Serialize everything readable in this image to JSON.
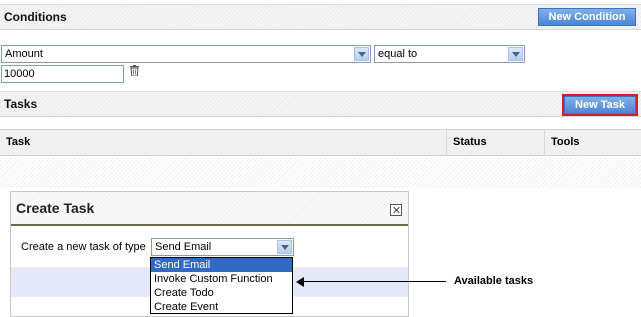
{
  "conditions": {
    "title": "Conditions",
    "new_button": "New Condition",
    "field_select": "Amount",
    "operator_select": "equal to",
    "value_input": "10000",
    "delete_icon": "trash-icon"
  },
  "tasks": {
    "title": "Tasks",
    "new_button": "New Task",
    "columns": [
      "Task",
      "Status",
      "Tools"
    ]
  },
  "modal": {
    "title": "Create Task",
    "close_icon": "close-icon",
    "prompt": "Create a new task of type",
    "type_select": "Send Email",
    "options": [
      "Send Email",
      "Invoke Custom Function",
      "Create Todo",
      "Create Event"
    ],
    "selected_index": 0
  },
  "annotation": {
    "label": "Available tasks"
  },
  "colors": {
    "button_blue": "#4a86d6",
    "highlight_outline": "#d0212b",
    "selection": "#316ac5"
  }
}
